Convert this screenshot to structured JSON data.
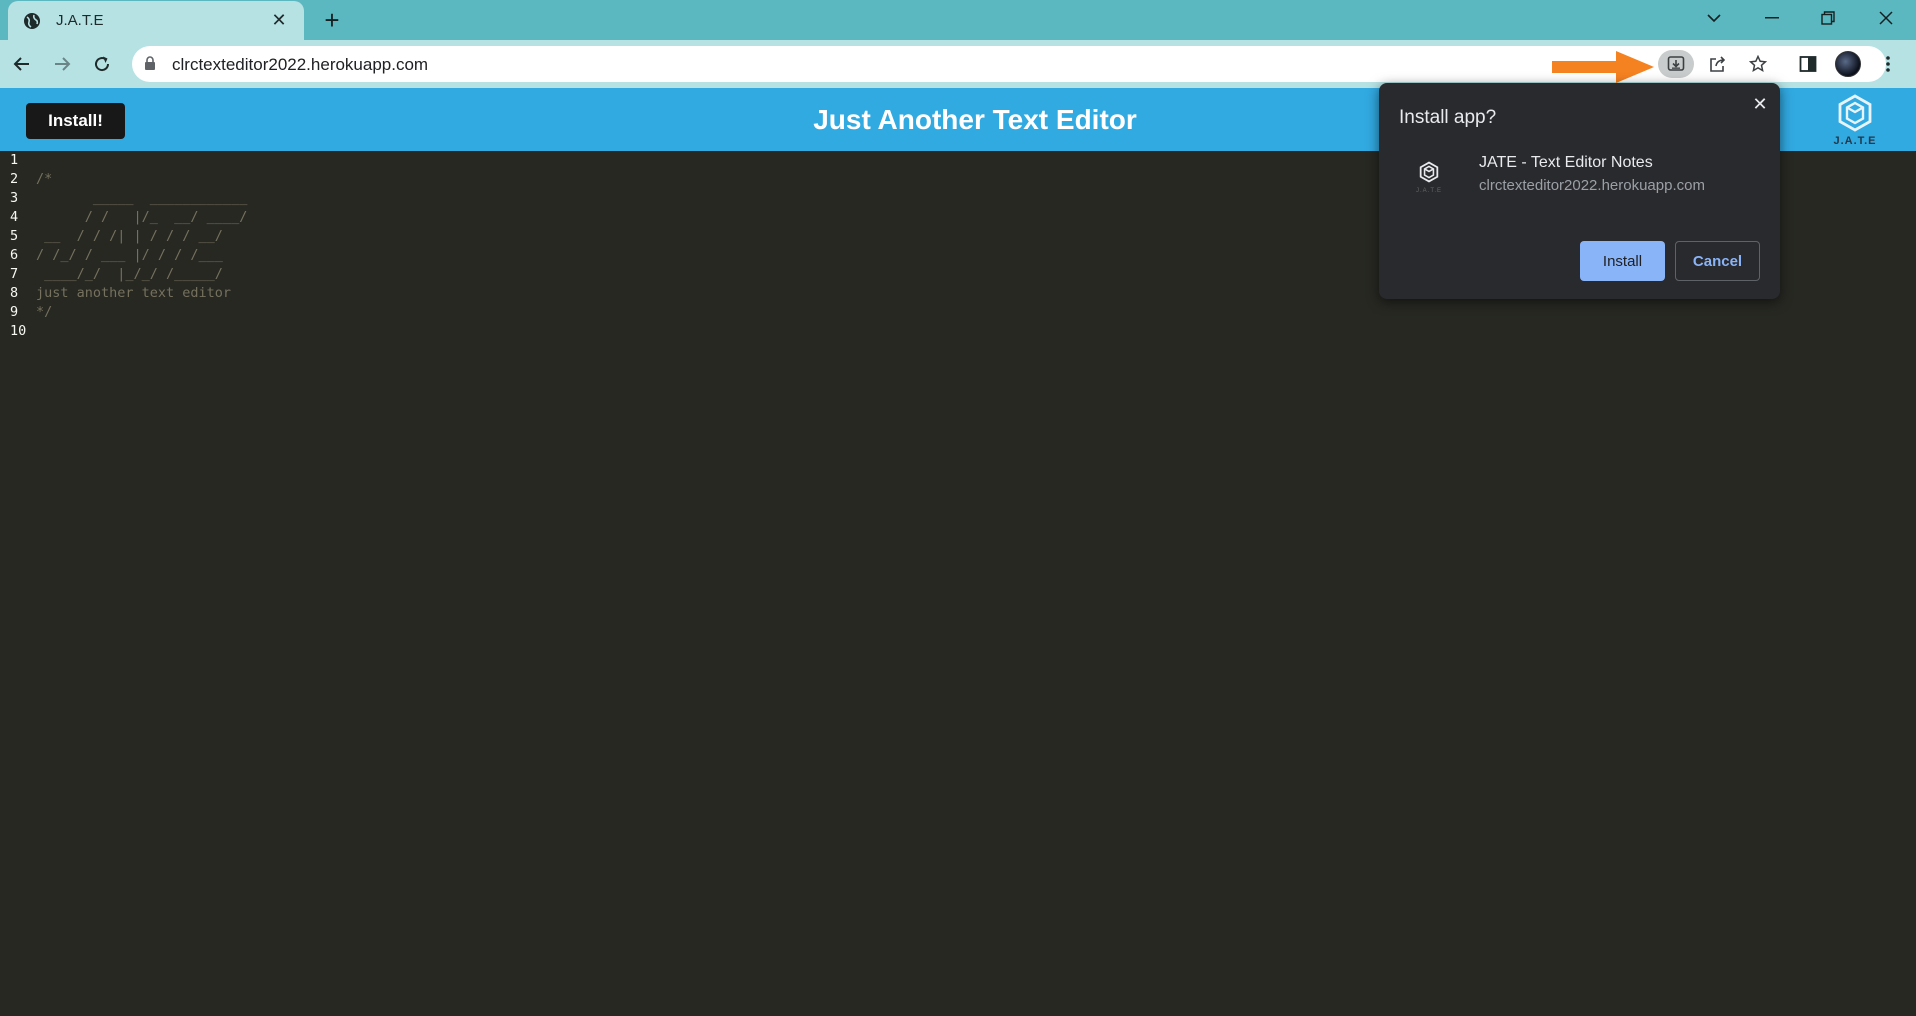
{
  "browser": {
    "tab_title": "J.A.T.E",
    "new_tab_label": "+",
    "close_tab_label": "✕",
    "url": "clrctexteditor2022.herokuapp.com"
  },
  "app": {
    "install_button": "Install!",
    "title": "Just Another Text Editor",
    "logo_text": "J.A.T.E",
    "editor_lines": [
      {
        "num": "1",
        "text": ""
      },
      {
        "num": "2",
        "text": "/*"
      },
      {
        "num": "3",
        "text": "       _____  ____________"
      },
      {
        "num": "4",
        "text": "      / /   |/_  __/ ____/"
      },
      {
        "num": "5",
        "text": " __  / / /| | / / / __/"
      },
      {
        "num": "6",
        "text": "/ /_/ / ___ |/ / / /___"
      },
      {
        "num": "7",
        "text": " ____/_/  |_/_/ /_____/"
      },
      {
        "num": "8",
        "text": "just another text editor"
      },
      {
        "num": "9",
        "text": "*/"
      },
      {
        "num": "10",
        "text": ""
      }
    ]
  },
  "popup": {
    "title": "Install app?",
    "close_label": "✕",
    "app_name": "JATE - Text Editor Notes",
    "app_url": "clrctexteditor2022.herokuapp.com",
    "install_label": "Install",
    "cancel_label": "Cancel",
    "icon_text": "J.A.T.E"
  },
  "colors": {
    "tabstrip": "#5bb8c0",
    "toolbar": "#b6e2e4",
    "header": "#31a9e1",
    "editor_bg": "#272822",
    "arrow": "#f58220"
  }
}
